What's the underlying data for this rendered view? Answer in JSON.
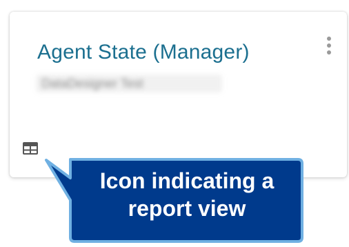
{
  "card": {
    "title": "Agent State (Manager)",
    "subtitle": "DataDesigner Test",
    "menu_icon": "kebab-menu-icon",
    "report_icon": "table-report-icon",
    "title_color": "#1b6f8f"
  },
  "callout": {
    "text": "Icon indicating a report view",
    "background_color": "#003a8c",
    "border_color": "#5aa0d8",
    "text_color": "#ffffff"
  }
}
